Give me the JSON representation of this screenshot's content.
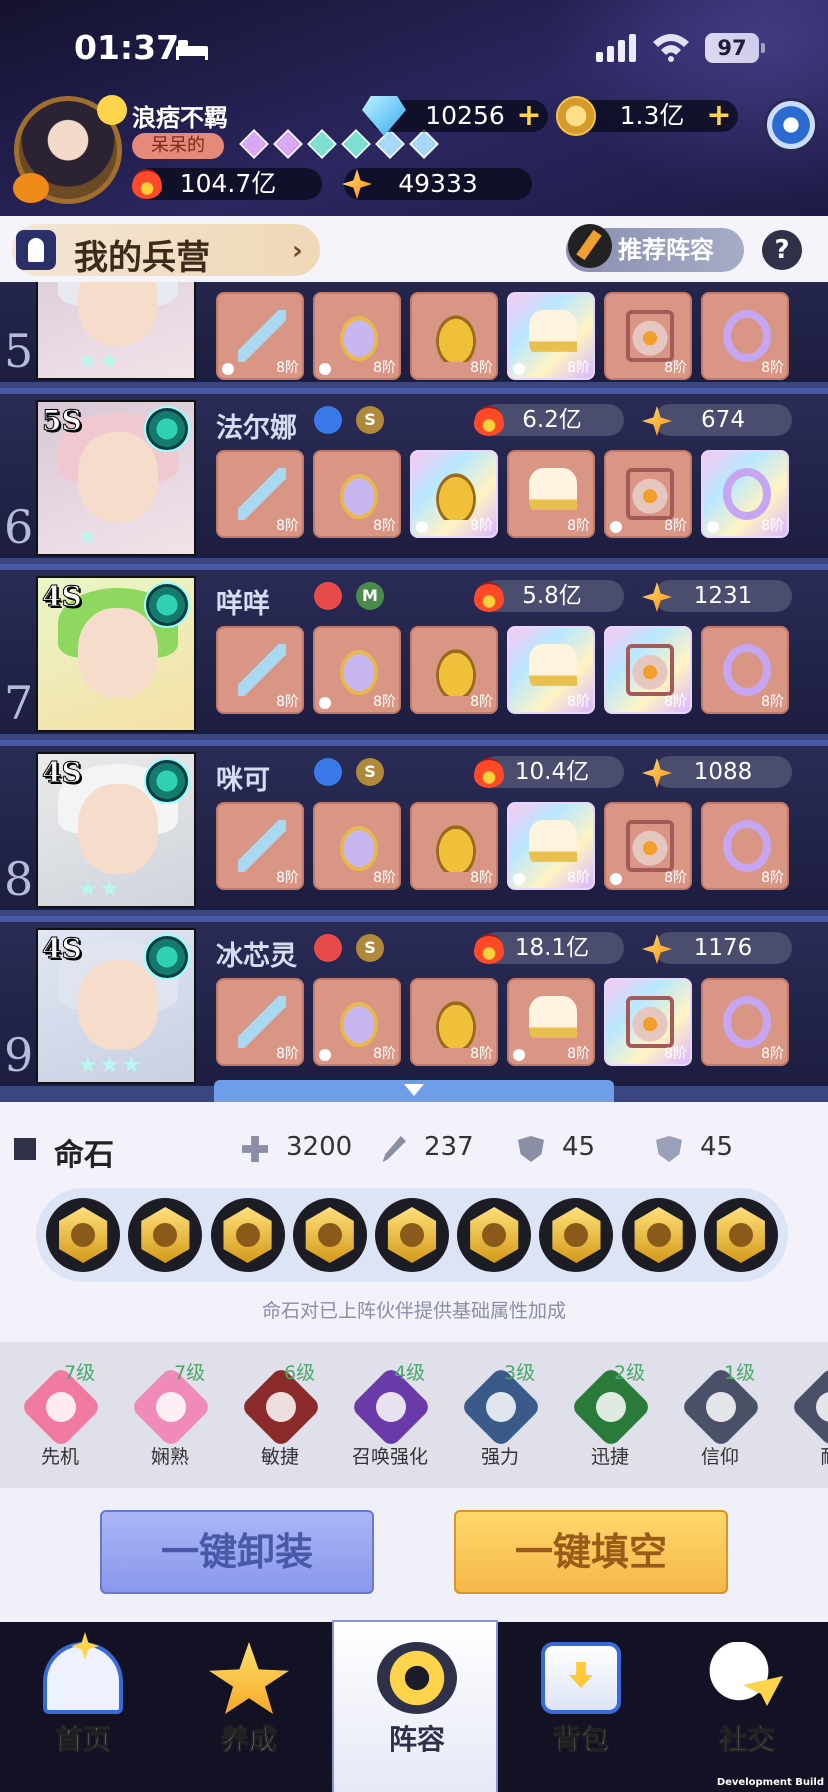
{
  "status_bar": {
    "time": "01:37",
    "battery": "97"
  },
  "player": {
    "name": "浪痞不羁",
    "title_tag": "呆呆的",
    "diamonds": "10256",
    "gold": "1.3亿",
    "power": "104.7亿",
    "stars": "49333"
  },
  "barracks": {
    "title": "我的兵营",
    "recommend_label": "推荐阵容",
    "help": "?"
  },
  "heroes": [
    {
      "number": "5",
      "grade": "",
      "name": "",
      "power": "",
      "stars": "",
      "equipment_tiers": [
        "8阶",
        "8阶",
        "8阶",
        "8阶",
        "8阶",
        "8阶"
      ]
    },
    {
      "number": "6",
      "grade": "5S",
      "name": "法尔娜",
      "rank": "S",
      "power": "6.2亿",
      "stars": "674",
      "equipment_tiers": [
        "8阶",
        "8阶",
        "8阶",
        "8阶",
        "8阶",
        "8阶"
      ]
    },
    {
      "number": "7",
      "grade": "4S",
      "name": "咩咩",
      "rank": "M",
      "power": "5.8亿",
      "stars": "1231",
      "equipment_tiers": [
        "8阶",
        "8阶",
        "8阶",
        "8阶",
        "8阶",
        "8阶"
      ]
    },
    {
      "number": "8",
      "grade": "4S",
      "name": "咪可",
      "rank": "S",
      "power": "10.4亿",
      "stars": "1088",
      "equipment_tiers": [
        "8阶",
        "8阶",
        "8阶",
        "8阶",
        "8阶",
        "8阶"
      ]
    },
    {
      "number": "9",
      "grade": "4S",
      "name": "冰芯灵",
      "rank": "S",
      "power": "18.1亿",
      "stars": "1176",
      "equipment_tiers": [
        "8阶",
        "8阶",
        "8阶",
        "8阶",
        "8阶",
        "8阶"
      ]
    }
  ],
  "fate_stone": {
    "title": "命石",
    "hp": "3200",
    "attack": "237",
    "defense": "45",
    "resist": "45",
    "note": "命石对已上阵伙伴提供基础属性加成"
  },
  "set_bonuses": [
    {
      "name": "先机",
      "level": "7级",
      "color": "#f07aa0"
    },
    {
      "name": "娴熟",
      "level": "7级",
      "color": "#f08ab8"
    },
    {
      "name": "敏捷",
      "level": "6级",
      "color": "#8a2a2a"
    },
    {
      "name": "召唤强化",
      "level": "4级",
      "color": "#6a3aa8"
    },
    {
      "name": "强力",
      "level": "3级",
      "color": "#3a5a8a"
    },
    {
      "name": "迅捷",
      "level": "2级",
      "color": "#2a7a3a"
    },
    {
      "name": "信仰",
      "level": "1级",
      "color": "#4a5068"
    },
    {
      "name": "耐",
      "level": "",
      "color": "#4a5068"
    }
  ],
  "actions": {
    "unequip_all": "一键卸装",
    "fill_all": "一键填空"
  },
  "nav": [
    {
      "label": "首页",
      "icon": "home-icon"
    },
    {
      "label": "养成",
      "icon": "star-icon"
    },
    {
      "label": "阵容",
      "icon": "lineup-icon",
      "active": true
    },
    {
      "label": "背包",
      "icon": "bag-icon"
    },
    {
      "label": "社交",
      "icon": "social-icon"
    }
  ],
  "footer": {
    "build_label": "Development Build"
  }
}
